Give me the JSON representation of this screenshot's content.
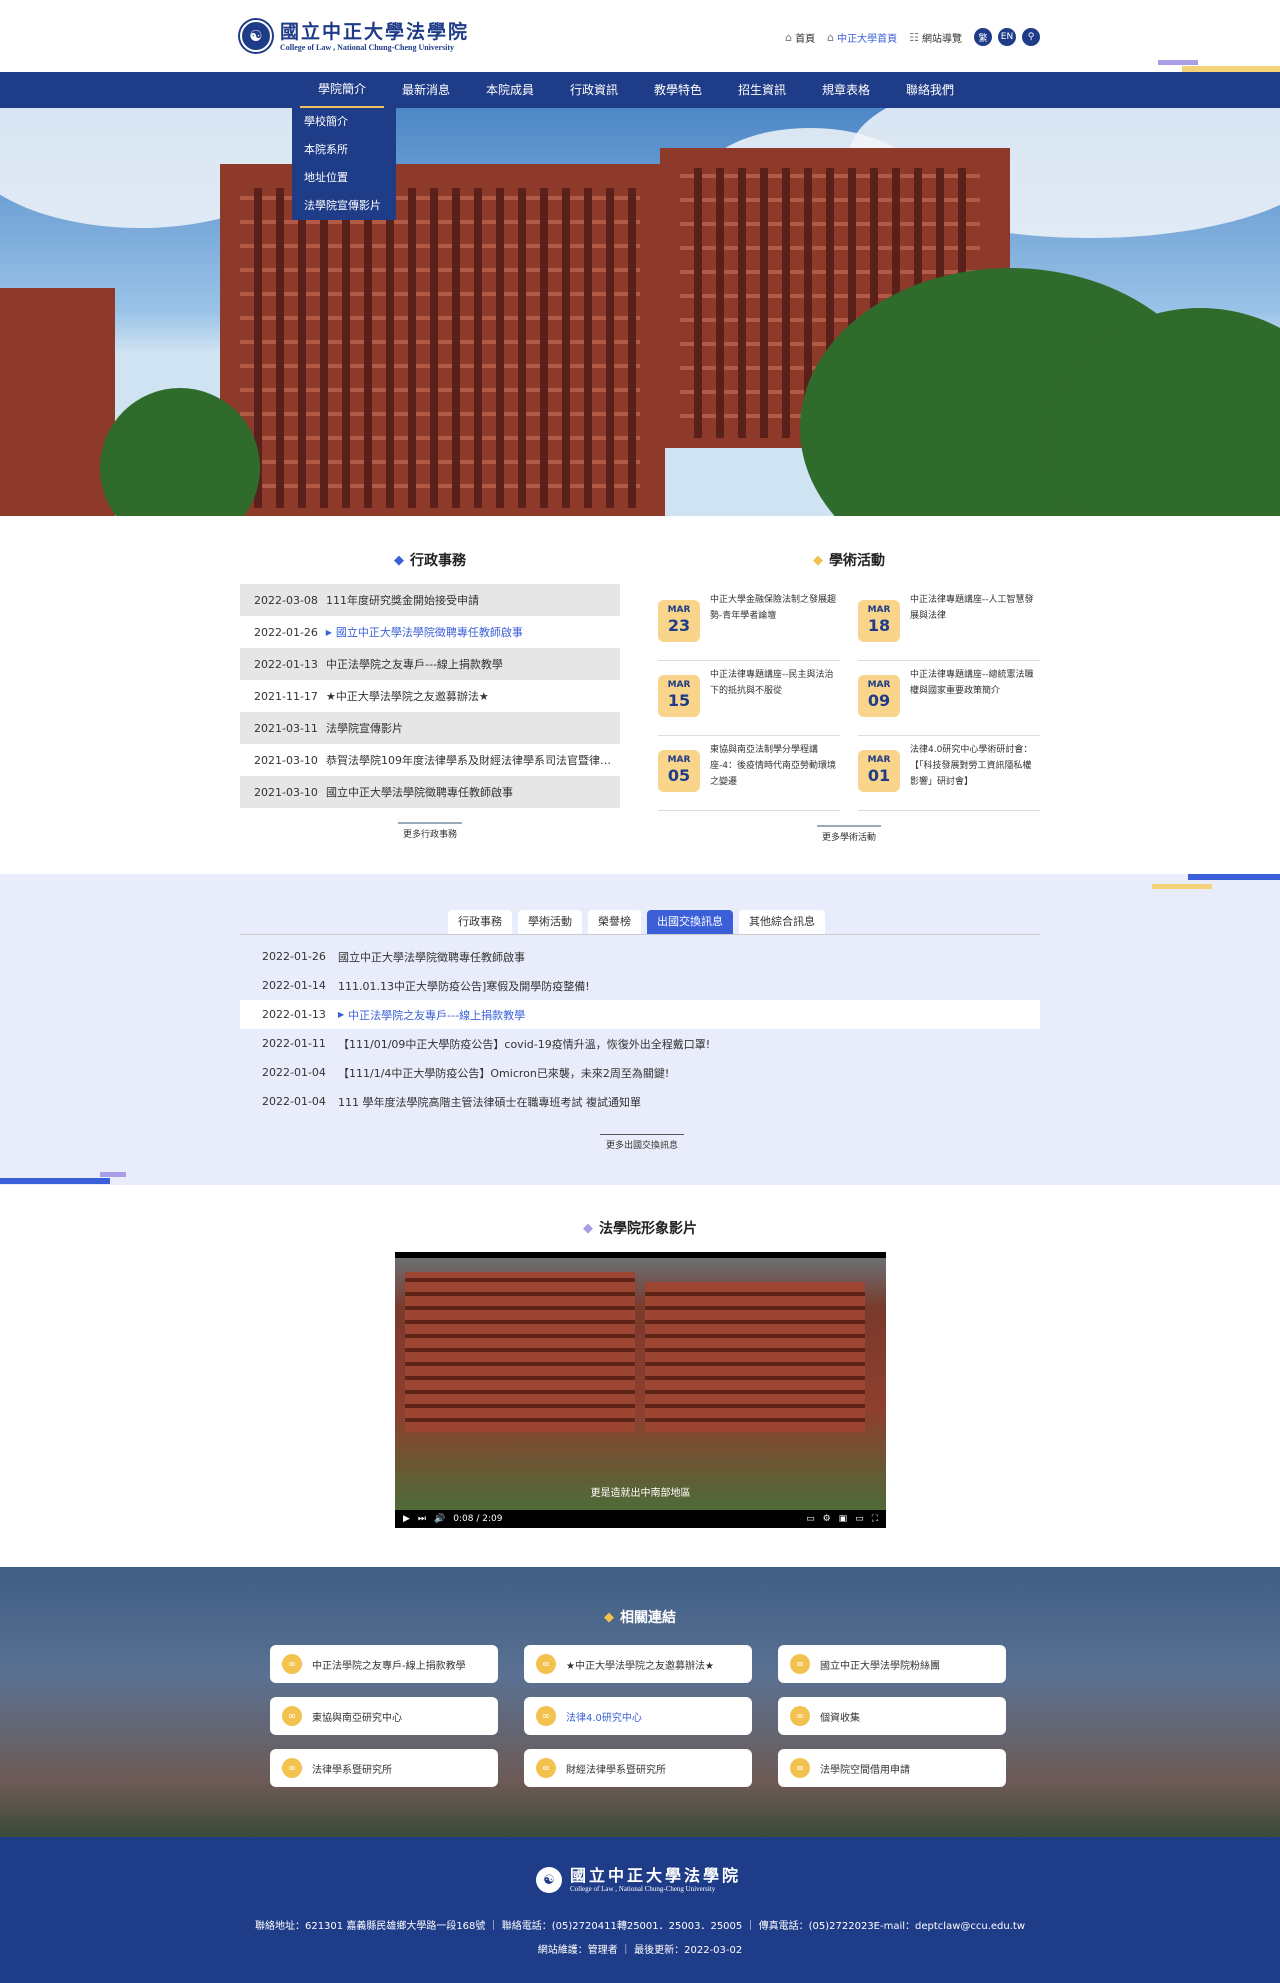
{
  "header": {
    "logo_zh": "國立中正大學法學院",
    "logo_en": "College of Law , National Chung-Cheng University",
    "util": {
      "home": "首頁",
      "ccu_home": "中正大學首頁",
      "sitemap": "網站導覽",
      "lang_tc": "繁",
      "lang_en": "EN"
    }
  },
  "nav": {
    "items": [
      "學院簡介",
      "最新消息",
      "本院成員",
      "行政資訊",
      "教學特色",
      "招生資訊",
      "規章表格",
      "聯絡我們"
    ],
    "dropdown": [
      "學校簡介",
      "本院系所",
      "地址位置",
      "法學院宣傳影片"
    ]
  },
  "admin": {
    "title": "行政事務",
    "rows": [
      {
        "date": "2022-03-08",
        "title": "111年度研究獎金開始接受申請"
      },
      {
        "date": "2022-01-26",
        "title": "國立中正大學法學院徵聘專任教師啟事"
      },
      {
        "date": "2022-01-13",
        "title": "中正法學院之友專戶---線上捐款教學"
      },
      {
        "date": "2021-11-17",
        "title": "★中正大學法學院之友邀募辦法★"
      },
      {
        "date": "2021-03-11",
        "title": "法學院宣傳影片"
      },
      {
        "date": "2021-03-10",
        "title": "恭賀法學院109年度法律學系及財經法律學系司法官暨律師..."
      },
      {
        "date": "2021-03-10",
        "title": "國立中正大學法學院徵聘專任教師啟事"
      }
    ],
    "more": "更多行政事務"
  },
  "academic": {
    "title": "學術活動",
    "events": [
      {
        "month": "MAR",
        "day": "23",
        "title": "中正大學金融保險法制之發展趨勢-青年學者論壇"
      },
      {
        "month": "MAR",
        "day": "18",
        "title": "中正法律專題講座--人工智慧發展與法律"
      },
      {
        "month": "MAR",
        "day": "15",
        "title": "中正法律專題講座--民主與法治下的抵抗與不服從"
      },
      {
        "month": "MAR",
        "day": "09",
        "title": "中正法律專題講座--總統憲法職權與國家重要政策簡介"
      },
      {
        "month": "MAR",
        "day": "05",
        "title": "東協與南亞法制學分學程講座-4：後疫情時代南亞勞動環境之變遷"
      },
      {
        "month": "MAR",
        "day": "01",
        "title": "法律4.0研究中心學術研討會：【「科技發展對勞工資訊隱私權影響」研討會】"
      }
    ],
    "more": "更多學術活動"
  },
  "tabs": {
    "labels": [
      "行政事務",
      "學術活動",
      "榮譽榜",
      "出國交換訊息",
      "其他綜合訊息"
    ],
    "rows": [
      {
        "date": "2022-01-26",
        "title": "國立中正大學法學院徵聘專任教師啟事"
      },
      {
        "date": "2022-01-14",
        "title": "111.01.13中正大學防疫公告]寒假及開學防疫整備!"
      },
      {
        "date": "2022-01-13",
        "title": "中正法學院之友專戶---線上捐款教學"
      },
      {
        "date": "2022-01-11",
        "title": "【111/01/09中正大學防疫公告】covid-19疫情升溫，恢復外出全程戴口罩!"
      },
      {
        "date": "2022-01-04",
        "title": "【111/1/4中正大學防疫公告】Omicron已來襲，未來2周至為關鍵!"
      },
      {
        "date": "2022-01-04",
        "title": "111 學年度法學院高階主管法律碩士在職專班考試 複試通知單"
      }
    ],
    "more": "更多出國交換訊息"
  },
  "video": {
    "title": "法學院形象影片",
    "subtitle": "更是造就出中南部地區",
    "time": "0:08 / 2:09"
  },
  "links": {
    "title": "相關連結",
    "items": [
      "中正法學院之友專戶-線上捐款教學",
      "★中正大學法學院之友邀募辦法★",
      "國立中正大學法學院粉絲團",
      "東協與南亞研究中心",
      "法律4.0研究中心",
      "個資收集",
      "法律學系暨研究所",
      "財經法律學系暨研究所",
      "法學院空間借用申請"
    ]
  },
  "footer": {
    "logo_zh": "國立中正大學法學院",
    "logo_en": "College of Law , National Chung-Cheng University",
    "address": "聯絡地址：621301 嘉義縣民雄鄉大學路一段168號 ｜ 聯絡電話：(05)2720411轉25001．25003．25005 ｜ 傳真電話：(05)2722023E-mail：deptclaw@ccu.edu.tw",
    "maintain": "網站維護：管理者 ｜ 最後更新：2022-03-02"
  },
  "colors": {
    "primary": "#1f3c88",
    "accent": "#3a5fd9",
    "gold": "#f8d58a"
  }
}
